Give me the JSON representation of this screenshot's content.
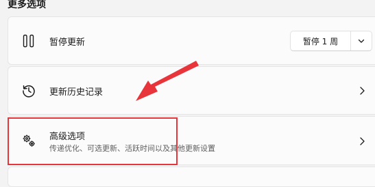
{
  "section": {
    "title": "更多选项"
  },
  "pause_updates": {
    "label": "暂停更新",
    "button_label": "暂停 1 周",
    "icon": "pause-icon"
  },
  "update_history": {
    "label": "更新历史记录",
    "icon": "history-icon"
  },
  "advanced_options": {
    "label": "高级选项",
    "description": "传递优化、可选更新、活跃时间以及其他更新设置",
    "icon": "gears-icon"
  },
  "annotation": {
    "highlight_color": "#e8353b"
  }
}
